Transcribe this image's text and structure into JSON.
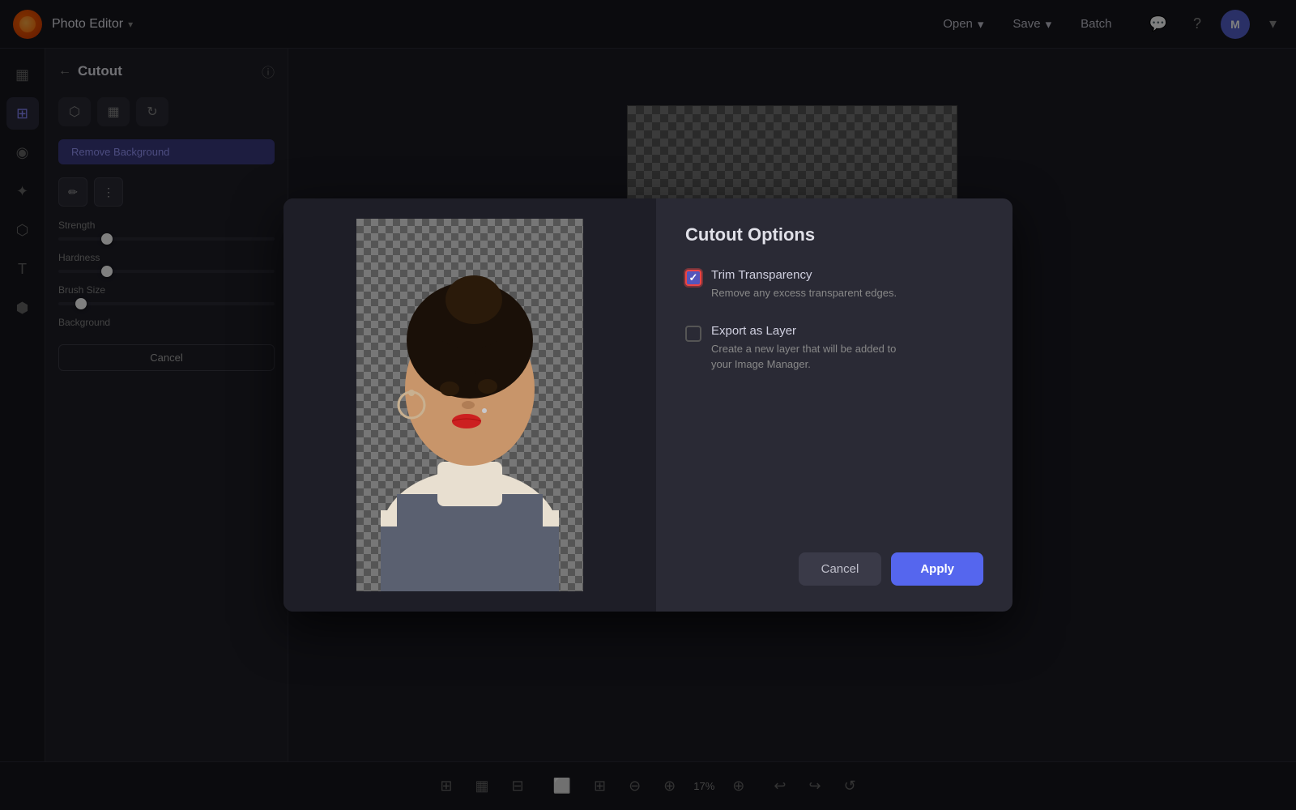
{
  "app": {
    "title": "Photo Editor",
    "logo_label": "Pixlr logo"
  },
  "topbar": {
    "title": "Photo Editor",
    "dropdown_icon": "▾",
    "nav_items": [
      {
        "label": "Open",
        "has_dropdown": true
      },
      {
        "label": "Save",
        "has_dropdown": true
      },
      {
        "label": "Batch",
        "has_dropdown": false
      }
    ],
    "chat_icon": "💬",
    "help_icon": "?",
    "avatar_label": "M"
  },
  "sidebar": {
    "icons": [
      {
        "name": "layers-icon",
        "symbol": "▦",
        "active": false
      },
      {
        "name": "adjustments-icon",
        "symbol": "⊞",
        "active": true
      },
      {
        "name": "eye-icon",
        "symbol": "◉",
        "active": false
      },
      {
        "name": "magic-icon",
        "symbol": "✦",
        "active": false
      },
      {
        "name": "stamp-icon",
        "symbol": "⬡",
        "active": false
      },
      {
        "name": "text-icon",
        "symbol": "T",
        "active": false
      },
      {
        "name": "shape-icon",
        "symbol": "⬢",
        "active": false
      }
    ]
  },
  "panel": {
    "back_label": "←",
    "title": "Cutout",
    "info_label": "ⓘ",
    "tabs": [
      {
        "label": "⬡",
        "name": "tab-image"
      },
      {
        "label": "▦",
        "name": "tab-layers"
      },
      {
        "label": "↻",
        "name": "tab-history"
      }
    ],
    "remove_bg_btn": "Remove Background",
    "tools": [
      {
        "label": "✏",
        "name": "brush-tool"
      },
      {
        "label": "⋮",
        "name": "wand-tool"
      }
    ],
    "sliders": [
      {
        "label": "Strength"
      },
      {
        "label": "Hardness"
      },
      {
        "label": "Brush Size"
      }
    ],
    "background_label": "Background",
    "cancel_btn": "Cancel"
  },
  "modal": {
    "title": "Cutout Options",
    "option1": {
      "label": "Trim Transparency",
      "description": "Remove any excess transparent edges.",
      "checked": true,
      "highlighted": true
    },
    "option2": {
      "label": "Export as Layer",
      "description": "Create a new layer that will be added to\nyour Image Manager.",
      "checked": false,
      "highlighted": false
    },
    "cancel_btn": "Cancel",
    "apply_btn": "Apply"
  },
  "bottombar": {
    "zoom_level": "17%",
    "tools": [
      "fit-icon",
      "zoom-in-icon",
      "zoom-out-icon",
      "undo-icon",
      "redo-icon"
    ]
  }
}
